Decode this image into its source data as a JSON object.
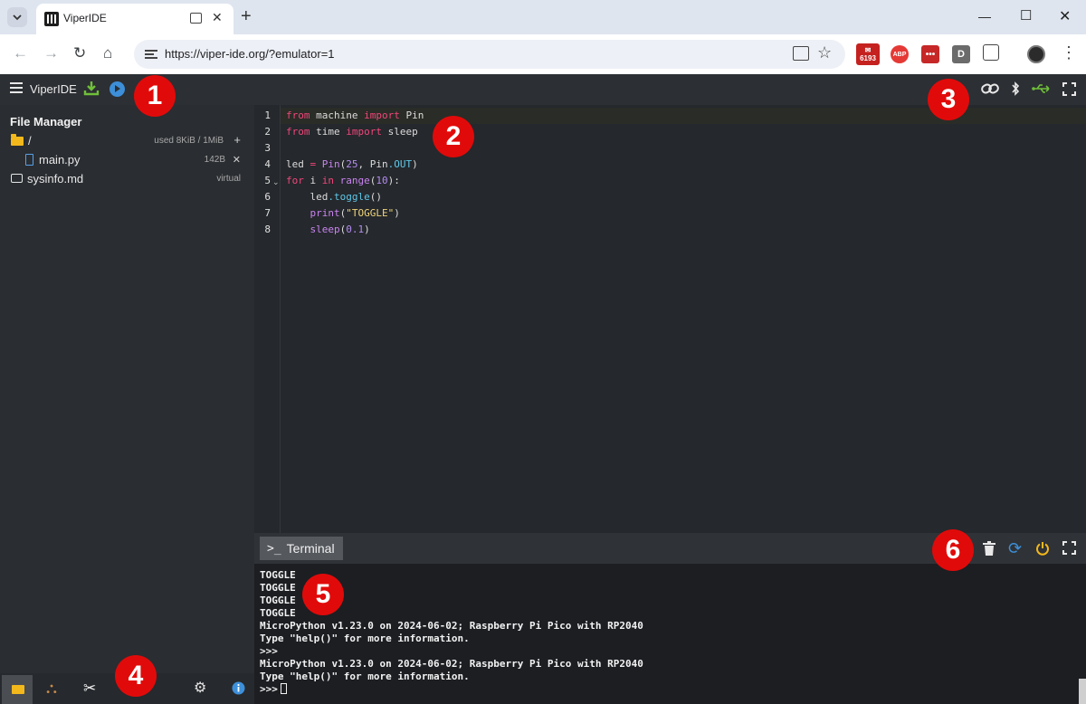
{
  "browser": {
    "tab_title": "ViperIDE",
    "url": "https://viper-ide.org/?emulator=1",
    "new_tab": "+",
    "tab_close": "✕",
    "ext_mail_count": "6193",
    "ext_abp": "ABP",
    "ext_lastpass": "•••",
    "ext_d": "D"
  },
  "app": {
    "title": "ViperIDE",
    "markers": [
      "1",
      "2",
      "3",
      "4",
      "5",
      "6"
    ]
  },
  "file_manager": {
    "title": "File Manager",
    "root": {
      "name": "/",
      "meta": "used 8KiB / 1MiB",
      "action": "+"
    },
    "files": [
      {
        "name": "main.py",
        "meta": "142B",
        "action": "✕"
      },
      {
        "name": "sysinfo.md",
        "meta": "virtual"
      }
    ]
  },
  "editor": {
    "line_numbers": [
      "1",
      "2",
      "3",
      "4",
      "5",
      "6",
      "7",
      "8"
    ]
  },
  "terminal": {
    "tab_label": "Terminal",
    "prompt_icon": ">_",
    "lines": [
      "TOGGLE",
      "TOGGLE",
      "TOGGLE",
      "TOGGLE",
      "MicroPython v1.23.0 on 2024-06-02; Raspberry Pi Pico with RP2040",
      "Type \"help()\" for more information.",
      ">>>",
      "MicroPython v1.23.0 on 2024-06-02; Raspberry Pi Pico with RP2040",
      "Type \"help()\" for more information.",
      ">>>"
    ]
  },
  "colors": {
    "accent_blue": "#3d8fd9",
    "accent_green": "#6fbf3a",
    "marker_red": "#e10a0a",
    "folder_yellow": "#f2b81c",
    "keyword_pink": "#f0467a"
  },
  "icons": {
    "topbar_right": [
      "link-icon",
      "bluetooth-icon",
      "usb-icon",
      "fullscreen-icon"
    ],
    "sidebar_bottom": [
      "folder-icon",
      "packages-icon",
      "tools-icon",
      "settings-icon",
      "info-icon"
    ],
    "terminal_right": [
      "trash-icon",
      "refresh-icon",
      "power-icon",
      "fullscreen-icon"
    ]
  }
}
